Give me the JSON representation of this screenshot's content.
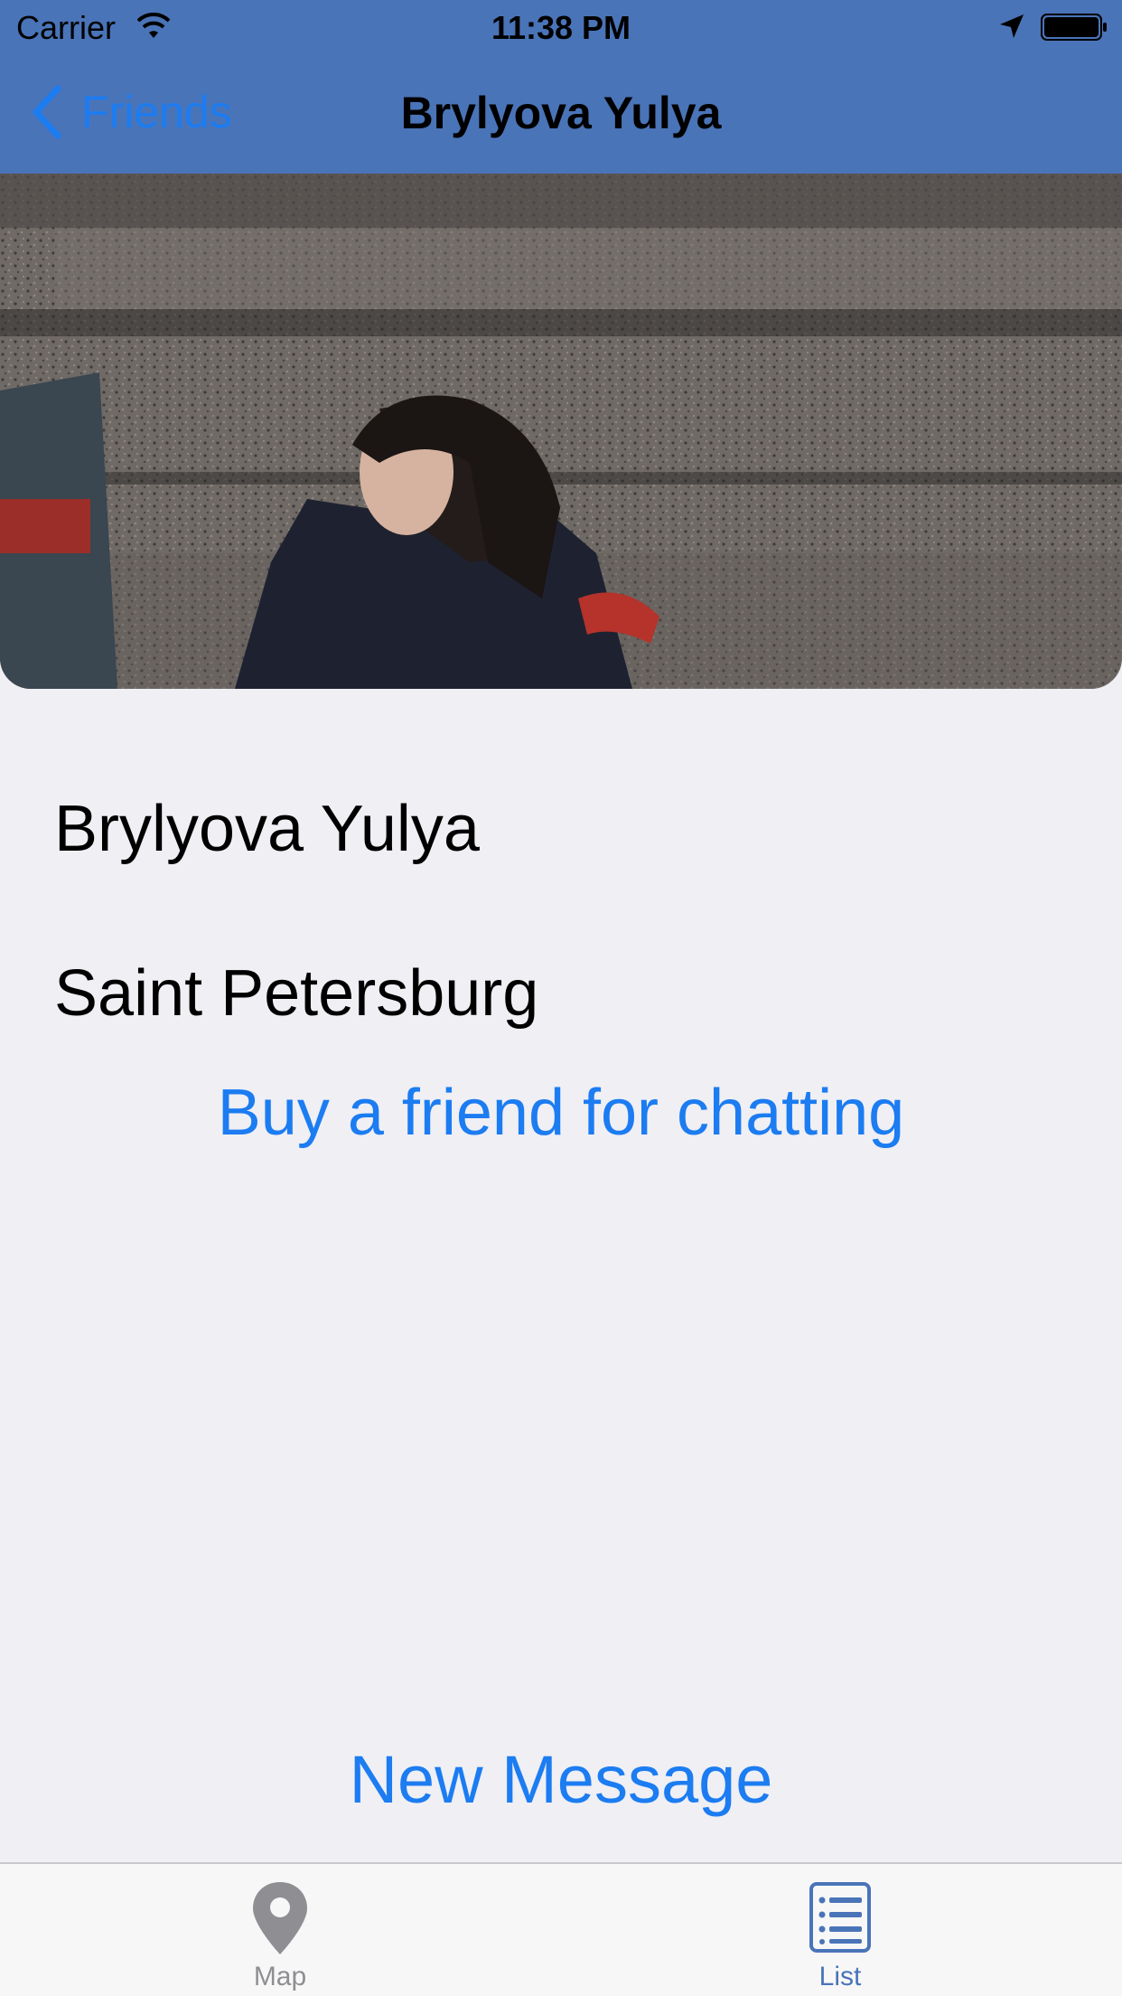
{
  "status_bar": {
    "carrier": "Carrier",
    "time": "11:38 PM",
    "icons": [
      "wifi-icon",
      "location-arrow-icon",
      "battery-icon"
    ]
  },
  "nav": {
    "back_label": "Friends",
    "title": "Brylyova Yulya"
  },
  "profile": {
    "photo_icon": "profile-photo",
    "name": "Brylyova Yulya",
    "city": "Saint Petersburg",
    "buy_link": "Buy a friend for chatting"
  },
  "actions": {
    "new_message": "New Message"
  },
  "tabbar": {
    "tabs": [
      {
        "label": "Map",
        "icon": "map-pin-icon",
        "selected": false
      },
      {
        "label": "List",
        "icon": "list-icon",
        "selected": true
      }
    ]
  },
  "colors": {
    "nav_bar": "#4a74b8",
    "accent": "#1c7cf1",
    "background": "#efeff4",
    "tab_selected": "#4a74b8",
    "tab_unselected": "#8e8e93"
  }
}
